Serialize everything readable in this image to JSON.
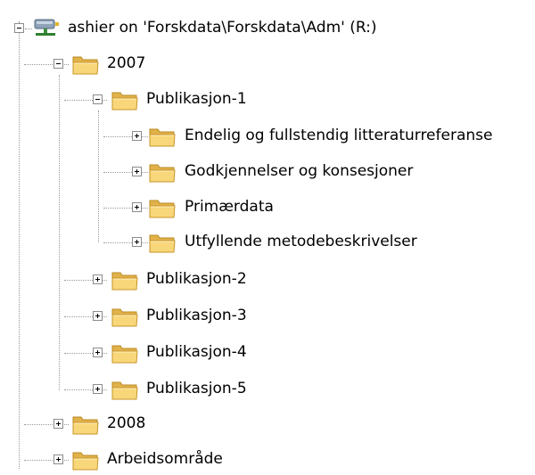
{
  "tree": {
    "root": {
      "label": "ashier on 'Forskdata\\Forskdata\\Adm' (R:)",
      "icon": "network-drive-icon",
      "expanded": true
    },
    "year_2007": {
      "label": "2007",
      "expanded": true
    },
    "pub1": {
      "label": "Publikasjon-1",
      "expanded": true
    },
    "pub1_children": [
      {
        "label": "Endelig og fullstendig litteraturreferanse"
      },
      {
        "label": "Godkjennelser og konsesjoner"
      },
      {
        "label": "Primærdata"
      },
      {
        "label": "Utfyllende metodebeskrivelser"
      }
    ],
    "pubs": [
      {
        "label": "Publikasjon-2"
      },
      {
        "label": "Publikasjon-3"
      },
      {
        "label": "Publikasjon-4"
      },
      {
        "label": "Publikasjon-5"
      }
    ],
    "year_2008": {
      "label": "2008"
    },
    "workspace": {
      "label": "Arbeidsområde"
    }
  },
  "colors": {
    "folder_fill": "#f7d271",
    "folder_edge": "#c9962a",
    "tree_lines": "#9a9a9a"
  }
}
